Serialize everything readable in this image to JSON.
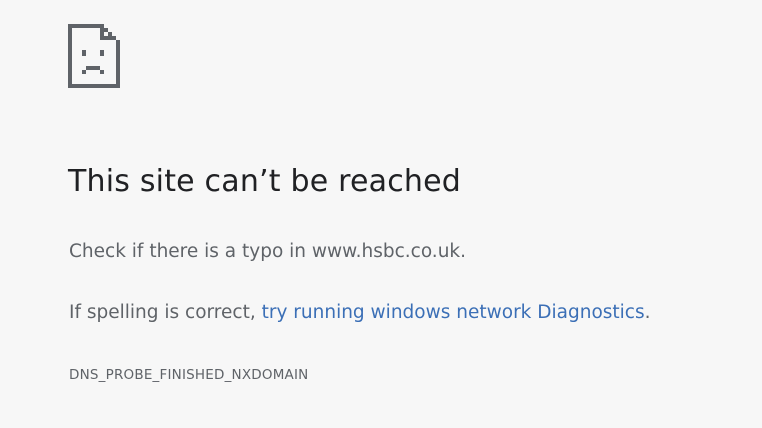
{
  "error_page": {
    "icon": "sad-page-icon",
    "title": "This site can’t be reached",
    "typo_message": "Check if there is a typo in www.hsbc.co.uk.",
    "spelling_prefix": "If spelling is correct, ",
    "diagnostics_link": "try running windows network Diagnostics",
    "spelling_suffix": ".",
    "error_code": "DNS_PROBE_FINISHED_NXDOMAIN"
  },
  "colors": {
    "background": "#f7f7f7",
    "title": "#202124",
    "body_text": "#5f6368",
    "link": "#3b6fb6"
  }
}
